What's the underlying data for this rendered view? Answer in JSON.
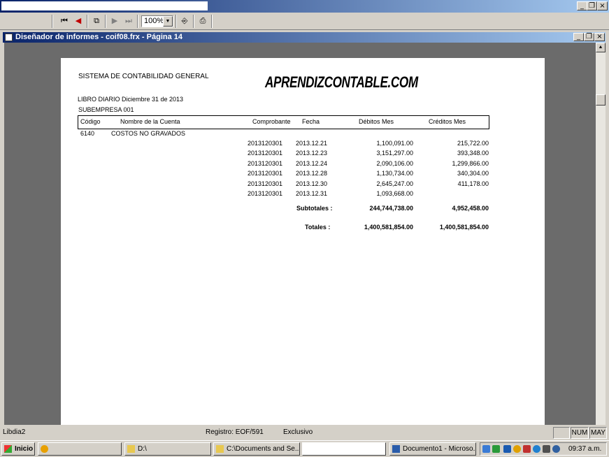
{
  "toolbar": {
    "zoom_value": "100%",
    "icons": [
      "first-page-icon",
      "previous-page-icon",
      "copy-pages-icon",
      "next-page-icon",
      "last-page-icon",
      "exit-preview-icon",
      "print-icon"
    ]
  },
  "window": {
    "title": "Diseñador de informes - coif08.frx - Página 14"
  },
  "report": {
    "system_name": "SISTEMA DE CONTABILIDAD GENERAL",
    "watermark": "APRENDIZCONTABLE.COM",
    "book_title": "LIBRO DIARIO Diciembre 31 de 2013",
    "subcompany": "SUBEMPRESA 001",
    "columns": {
      "code": "Código",
      "account_name": "Nombre de la Cuenta",
      "voucher": "Comprobante",
      "date": "Fecha",
      "debits": "Débitos Mes",
      "credits": "Créditos Mes"
    },
    "account": {
      "code": "6140",
      "name": "COSTOS NO GRAVADOS"
    },
    "rows": [
      {
        "voucher": "2013120301",
        "date": "2013.12.21",
        "debit": "1,100,091.00",
        "credit": "215,722.00"
      },
      {
        "voucher": "2013120301",
        "date": "2013.12.23",
        "debit": "3,151,297.00",
        "credit": "393,348.00"
      },
      {
        "voucher": "2013120301",
        "date": "2013.12.24",
        "debit": "2,090,106.00",
        "credit": "1,299,866.00"
      },
      {
        "voucher": "2013120301",
        "date": "2013.12.28",
        "debit": "1,130,734.00",
        "credit": "340,304.00"
      },
      {
        "voucher": "2013120301",
        "date": "2013.12.30",
        "debit": "2,645,247.00",
        "credit": "411,178.00"
      },
      {
        "voucher": "2013120301",
        "date": "2013.12.31",
        "debit": "1,093,668.00",
        "credit": ""
      }
    ],
    "subtotals": {
      "label": "Subtotales :",
      "debit": "244,744,738.00",
      "credit": "4,952,458.00"
    },
    "totals": {
      "label": "Totales :",
      "debit": "1,400,581,854.00",
      "credit": "1,400,581,854.00"
    }
  },
  "statusbar": {
    "table": "Libdia2",
    "record": "Registro: EOF/591",
    "mode": "Exclusivo",
    "num": "NUM",
    "caps": "MAY"
  },
  "taskbar": {
    "start": "Inicio",
    "tasks": [
      "D:\\",
      "C:\\Documents and Se...",
      "Documento1 - Microso..."
    ],
    "clock": "09:37 a.m."
  },
  "colors": {
    "title_gradient_start": "#0a246a",
    "title_gradient_end": "#a6caf0",
    "workspace": "#6b6b6b",
    "chrome": "#d4d0c8"
  }
}
